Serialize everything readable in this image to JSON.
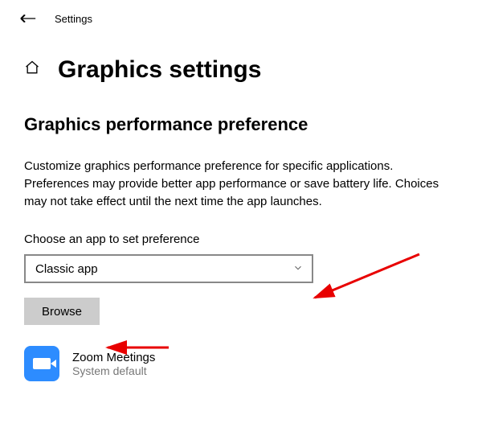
{
  "topbar": {
    "title": "Settings"
  },
  "header": {
    "title": "Graphics settings"
  },
  "section": {
    "heading": "Graphics performance preference",
    "description": "Customize graphics performance preference for specific applications. Preferences may provide better app performance or save battery life. Choices may not take effect until the next time the app launches.",
    "choose_label": "Choose an app to set preference",
    "dropdown_value": "Classic app",
    "browse_label": "Browse"
  },
  "apps": [
    {
      "name": "Zoom Meetings",
      "subtitle": "System default",
      "icon": "zoom"
    }
  ]
}
